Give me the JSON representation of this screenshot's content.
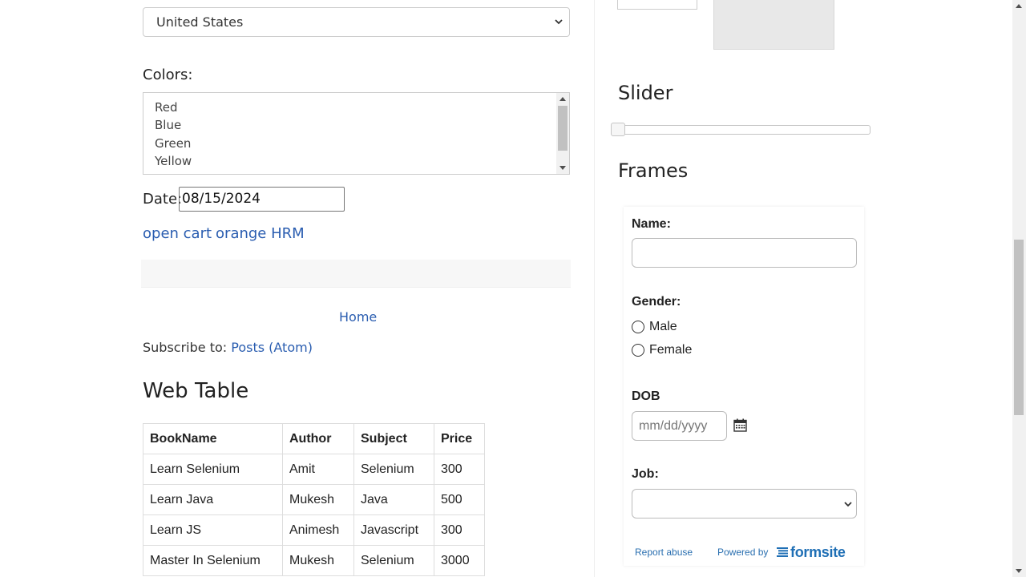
{
  "country_select": {
    "value": "United States"
  },
  "colors": {
    "label": "Colors:",
    "options": [
      "Red",
      "Blue",
      "Green",
      "Yellow"
    ]
  },
  "date": {
    "label": "Date:",
    "value": "08/15/2024"
  },
  "links": {
    "first": "open cart",
    "second": "orange HRM"
  },
  "home_link": "Home",
  "subscribe": {
    "text": "Subscribe to:",
    "link": "Posts (Atom)"
  },
  "web_table": {
    "title": "Web Table",
    "headers": [
      "BookName",
      "Author",
      "Subject",
      "Price"
    ],
    "rows": [
      [
        "Learn Selenium",
        "Amit",
        "Selenium",
        "300"
      ],
      [
        "Learn Java",
        "Mukesh",
        "Java",
        "500"
      ],
      [
        "Learn JS",
        "Animesh",
        "Javascript",
        "300"
      ],
      [
        "Master In Selenium",
        "Mukesh",
        "Selenium",
        "3000"
      ]
    ]
  },
  "slider": {
    "title": "Slider",
    "value_fraction": 0.0
  },
  "frames": {
    "title": "Frames",
    "form": {
      "name_label": "Name:",
      "gender_label": "Gender:",
      "gender_options": [
        "Male",
        "Female"
      ],
      "dob_label": "DOB",
      "dob_placeholder": "mm/dd/yyyy",
      "job_label": "Job:",
      "report_abuse": "Report abuse",
      "powered_by": "Powered by",
      "brand": "formsite"
    }
  },
  "colors_theme": {
    "link": "#2a5db0",
    "formsite_blue": "#1f6fb5"
  },
  "icons": [
    "chevron-down-icon",
    "calendar-icon",
    "formsite-logo-icon"
  ]
}
